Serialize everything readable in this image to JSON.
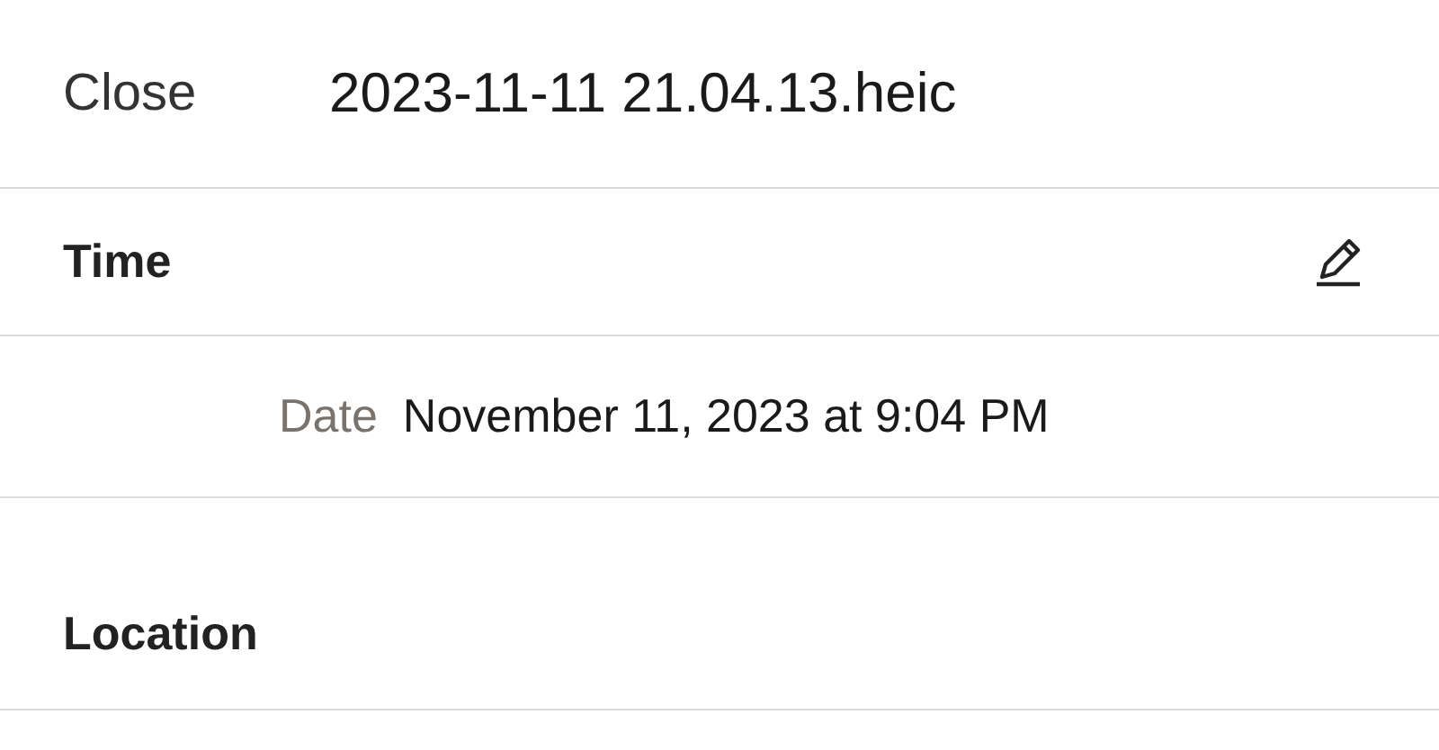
{
  "header": {
    "close": "Close",
    "title": "2023-11-11 21.04.13.heic"
  },
  "sections": [
    {
      "kind": "editable",
      "title": "Time",
      "fields": [
        {
          "label": "Date",
          "value": "November 11, 2023 at 9:04 PM"
        }
      ]
    },
    {
      "kind": "plain",
      "title": "Location"
    }
  ]
}
